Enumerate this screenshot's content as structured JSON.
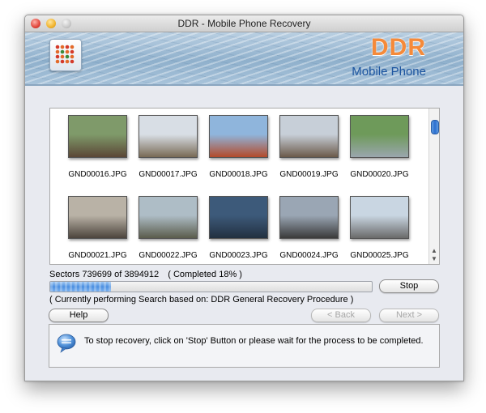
{
  "window": {
    "title": "DDR - Mobile Phone Recovery"
  },
  "banner": {
    "brand": "DDR",
    "subtitle": "Mobile Phone"
  },
  "thumbnails": [
    {
      "name": "GND00016.JPG",
      "colors": [
        "#7f9a6a",
        "#5b4636"
      ]
    },
    {
      "name": "GND00017.JPG",
      "colors": [
        "#d8dee5",
        "#786a55"
      ]
    },
    {
      "name": "GND00018.JPG",
      "colors": [
        "#8fb5dc",
        "#b34a2a"
      ]
    },
    {
      "name": "GND00019.JPG",
      "colors": [
        "#c7cfd8",
        "#6b5a4a"
      ]
    },
    {
      "name": "GND00020.JPG",
      "colors": [
        "#6e9a5a",
        "#9aa6ae"
      ]
    },
    {
      "name": "GND00021.JPG",
      "colors": [
        "#b9b2a6",
        "#4c443c"
      ]
    },
    {
      "name": "GND00022.JPG",
      "colors": [
        "#aebdc6",
        "#5a5c4c"
      ]
    },
    {
      "name": "GND00023.JPG",
      "colors": [
        "#3d5a7a",
        "#223040"
      ]
    },
    {
      "name": "GND00024.JPG",
      "colors": [
        "#9aa6b4",
        "#3a3a3a"
      ]
    },
    {
      "name": "GND00025.JPG",
      "colors": [
        "#c9d6e2",
        "#6a6a6a"
      ]
    }
  ],
  "progress": {
    "sectors_text": "Sectors 739699 of 3894912",
    "completed_text": "( Completed 18% )",
    "fraction": 0.19,
    "stop_label": "Stop",
    "status_text": "( Currently performing Search based on: DDR General Recovery Procedure )"
  },
  "nav": {
    "help_label": "Help",
    "back_label": "< Back",
    "next_label": "Next >"
  },
  "info": {
    "message": "To stop recovery, click on 'Stop' Button or please wait for the process to be completed."
  },
  "colors": {
    "brand_orange": "#f58a3a",
    "brand_blue": "#1d55a0",
    "progress_blue": "#4c8fe0"
  }
}
